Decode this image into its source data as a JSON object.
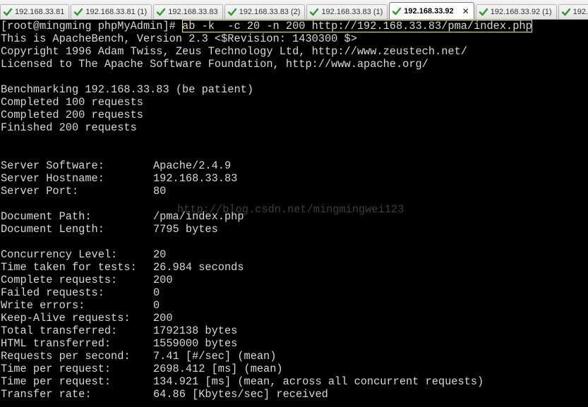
{
  "tabs": [
    {
      "label": "192.168.33.81",
      "active": false
    },
    {
      "label": "192.168.33.81 (1)",
      "active": false
    },
    {
      "label": "192.168.33.83",
      "active": false
    },
    {
      "label": "192.168.33.83 (2)",
      "active": false
    },
    {
      "label": "192.168.33.83 (1)",
      "active": false
    },
    {
      "label": "192.168.33.92",
      "active": true
    },
    {
      "label": "192.168.33.92 (1)",
      "active": false
    },
    {
      "label": "192.1",
      "active": false
    }
  ],
  "colors": {
    "check": "#2a9a2a",
    "highlight": "#f2f26a",
    "text": "#d8d8d8",
    "background": "#000000"
  },
  "terminal": {
    "prompt": "[root@mingming phpMyAdmin]# ",
    "command": "ab -k  -c 20 -n 200 http://192.168.33.83/pma/index.php",
    "header_lines": [
      "This is ApacheBench, Version 2.3 <$Revision: 1430300 $>",
      "Copyright 1996 Adam Twiss, Zeus Technology Ltd, http://www.zeustech.net/",
      "Licensed to The Apache Software Foundation, http://www.apache.org/",
      "",
      "Benchmarking 192.168.33.83 (be patient)",
      "Completed 100 requests",
      "Completed 200 requests",
      "Finished 200 requests",
      "",
      ""
    ],
    "stats": [
      {
        "key": "Server Software:",
        "value": "Apache/2.4.9"
      },
      {
        "key": "Server Hostname:",
        "value": "192.168.33.83"
      },
      {
        "key": "Server Port:",
        "value": "80"
      },
      {
        "key": "",
        "value": ""
      },
      {
        "key": "Document Path:",
        "value": "/pma/index.php"
      },
      {
        "key": "Document Length:",
        "value": "7795 bytes"
      },
      {
        "key": "",
        "value": ""
      },
      {
        "key": "Concurrency Level:",
        "value": "20"
      },
      {
        "key": "Time taken for tests:",
        "value": "26.984 seconds"
      },
      {
        "key": "Complete requests:",
        "value": "200"
      },
      {
        "key": "Failed requests:",
        "value": "0"
      },
      {
        "key": "Write errors:",
        "value": "0"
      },
      {
        "key": "Keep-Alive requests:",
        "value": "200"
      },
      {
        "key": "Total transferred:",
        "value": "1792138 bytes"
      },
      {
        "key": "HTML transferred:",
        "value": "1559000 bytes"
      },
      {
        "key": "Requests per second:",
        "value": "7.41 [#/sec] (mean)"
      },
      {
        "key": "Time per request:",
        "value": "2698.412 [ms] (mean)"
      },
      {
        "key": "Time per request:",
        "value": "134.921 [ms] (mean, across all concurrent requests)"
      },
      {
        "key": "Transfer rate:",
        "value": "64.86 [Kbytes/sec] received"
      }
    ]
  },
  "watermark": "http://blog.csdn.net/mingmingwei123"
}
